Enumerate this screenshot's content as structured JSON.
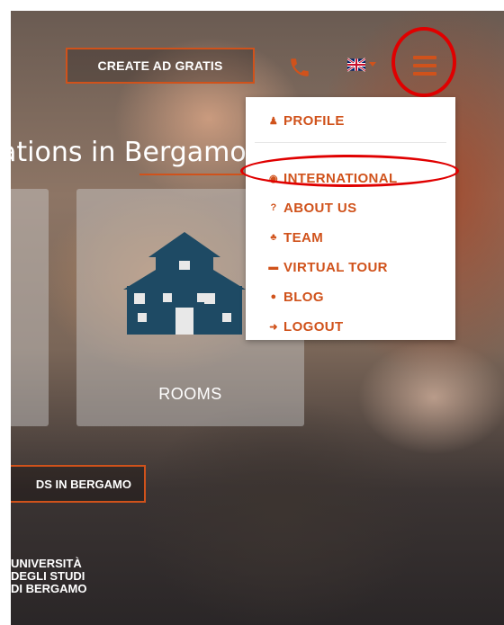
{
  "header": {
    "create_ad_label": "CREATE AD GRATIS",
    "phone_icon": "phone-icon",
    "language_flag": "uk-flag-icon",
    "menu_icon": "hamburger-menu-icon"
  },
  "hero": {
    "heading": "ations in Bergamo"
  },
  "cards": [
    {
      "label": ""
    },
    {
      "label": "ROOMS",
      "icon": "house-icon"
    }
  ],
  "ads_button_label": "DS IN BERGAMO",
  "university_logo": [
    "UNIVERSITÀ",
    "DEGLI STUDI",
    "DI BERGAMO"
  ],
  "menu": {
    "items": [
      {
        "label": "PROFILE",
        "icon": "user-icon",
        "glyph": "♟"
      },
      {
        "label": "INTERNATIONAL",
        "icon": "globe-icon",
        "glyph": "◉"
      },
      {
        "label": "ABOUT US",
        "icon": "question-icon",
        "glyph": "?"
      },
      {
        "label": "TEAM",
        "icon": "group-icon",
        "glyph": "♣"
      },
      {
        "label": "VIRTUAL TOUR",
        "icon": "vr-goggles-icon",
        "glyph": "▬"
      },
      {
        "label": "BLOG",
        "icon": "comment-icon",
        "glyph": "●"
      },
      {
        "label": "LOGOUT",
        "icon": "logout-icon",
        "glyph": "➜"
      }
    ]
  },
  "colors": {
    "accent": "#d0521b",
    "annotation": "#e00000"
  }
}
